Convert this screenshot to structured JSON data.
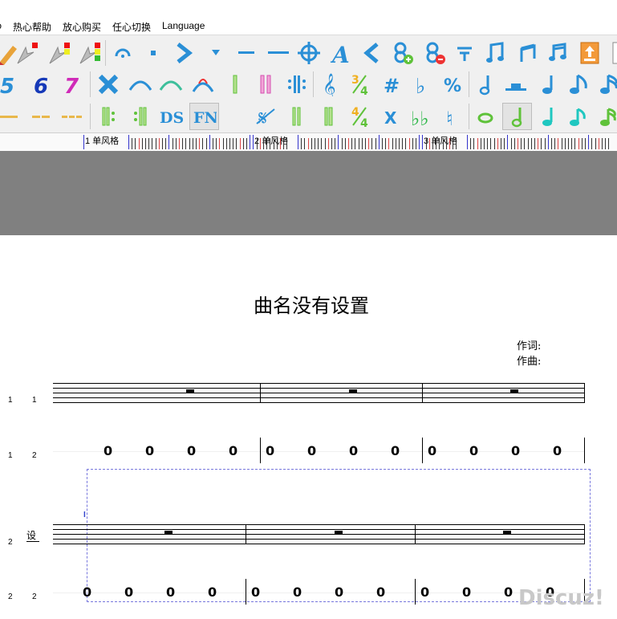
{
  "menu": [
    "ↄ",
    "热心帮助",
    "放心购买",
    "任心切换",
    "Language"
  ],
  "ruler": {
    "measures": [
      "1 单风格",
      "2 单风格",
      "3 单风格"
    ]
  },
  "score": {
    "title": "曲名没有设置",
    "lyricist_label": "作词:",
    "composer_label": "作曲:",
    "row_numbers": [
      {
        "a": "1",
        "b": "1"
      },
      {
        "a": "1",
        "b": "2"
      },
      {
        "a": "2",
        "b": ""
      },
      {
        "a": "2",
        "b": "2"
      }
    ],
    "instrument_label": "设",
    "cursor_label": "I",
    "jianpu_rows": [
      [
        "0",
        "0",
        "0",
        "0",
        "0",
        "0",
        "0",
        "0",
        "0",
        "0",
        "0",
        "0"
      ],
      [
        "0",
        "0",
        "0",
        "0",
        "0",
        "0",
        "0",
        "0",
        "0",
        "0",
        "0",
        "0"
      ]
    ],
    "watermark": "Discuz!"
  },
  "colors": {
    "accent_blue": "#2a8fd6",
    "accent_green": "#5fc23a",
    "toolbar_bg": "#f0f0f0",
    "gray_area": "#808080"
  },
  "toolbar_rows": [
    [
      "pencil-icon",
      "arrow-red-icon",
      "arrow-redyellow-icon",
      "arrow-rgb-icon",
      "fermata-icon",
      "dot-icon",
      "accent-icon",
      "triangle-down-icon",
      "dash-icon",
      "long-dash-icon",
      "crosshair-icon",
      "text-a-icon",
      "decrescendo-icon",
      "add-note-icon",
      "remove-note-icon",
      "lines-icon",
      "eighth-pair-icon",
      "beam-icon",
      "sixteenth-icon",
      "export-icon"
    ],
    [
      "digit-5-icon",
      "digit-6-icon",
      "digit-7-icon",
      "cross-icon",
      "slur-icon",
      "tie-icon",
      "bend-icon",
      "single-bar-icon",
      "double-bar-icon",
      "repeat-bar-icon",
      "treble-clef-icon",
      "time-sig-34-icon",
      "sharp-icon",
      "flat-icon",
      "percent-icon",
      "half-note-icon",
      "rest-bar-icon",
      "quarter-note-icon",
      "eighth-note-icon",
      "sixteenth-note-icon"
    ],
    [
      "underline1-icon",
      "underline2-icon",
      "underline3-icon",
      "repeat-start-icon",
      "repeat-end-icon",
      "ds-icon",
      "fn-icon",
      "segno-icon",
      "barline-icon",
      "final-bar-icon",
      "time-sig-44-icon",
      "double-sharp-icon",
      "double-flat-icon",
      "natural-icon",
      "whole-note-icon",
      "half-note-icon",
      "quarter-note-icon",
      "eighth-note-icon",
      "sixteenth-note-icon"
    ]
  ],
  "toolbar_text": {
    "ds": "DS",
    "fn": "FN",
    "five": "5",
    "six": "6",
    "seven": "7",
    "x": "X",
    "bb": "bb",
    "sharp": "#"
  }
}
